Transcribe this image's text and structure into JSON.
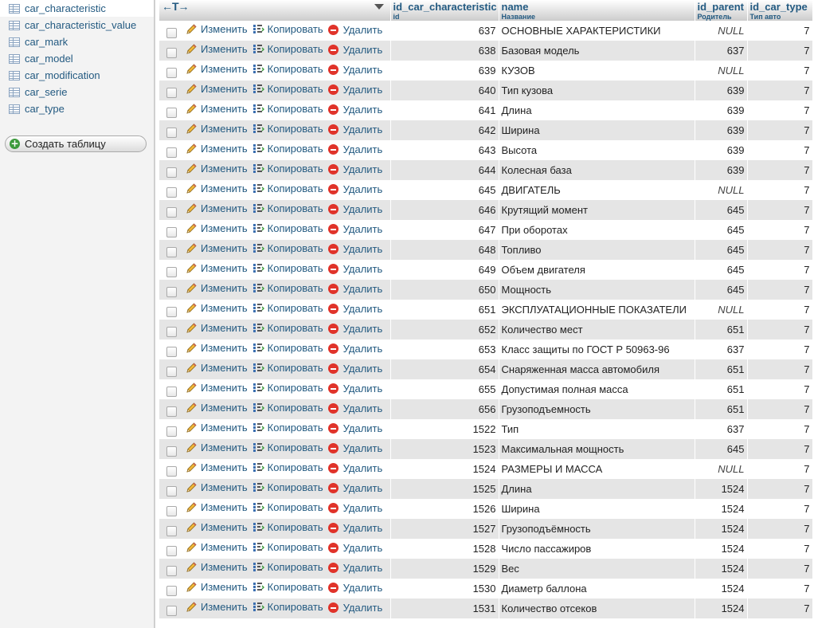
{
  "sidebar": {
    "tables": [
      {
        "name": "car_characteristic",
        "active": true
      },
      {
        "name": "car_characteristic_value",
        "active": false
      },
      {
        "name": "car_mark",
        "active": false
      },
      {
        "name": "car_model",
        "active": false
      },
      {
        "name": "car_modification",
        "active": false
      },
      {
        "name": "car_serie",
        "active": false
      },
      {
        "name": "car_type",
        "active": false
      }
    ],
    "create_table_label": "Создать таблицу"
  },
  "grid": {
    "header": {
      "arrows": "←T→",
      "columns": [
        {
          "name": "id_car_characteristic",
          "comment": "id"
        },
        {
          "name": "name",
          "comment": "Название"
        },
        {
          "name": "id_parent",
          "comment": "Родитель"
        },
        {
          "name": "id_car_type",
          "comment": "Тип авто"
        }
      ]
    },
    "actions": {
      "edit": "Изменить",
      "copy": "Копировать",
      "delete": "Удалить"
    },
    "null_label": "NULL",
    "rows": [
      {
        "id": "637",
        "name": "ОСНОВНЫЕ ХАРАКТЕРИСТИКИ",
        "parent": null,
        "type": "7"
      },
      {
        "id": "638",
        "name": "Базовая модель",
        "parent": "637",
        "type": "7"
      },
      {
        "id": "639",
        "name": "КУЗОВ",
        "parent": null,
        "type": "7"
      },
      {
        "id": "640",
        "name": "Тип кузова",
        "parent": "639",
        "type": "7"
      },
      {
        "id": "641",
        "name": "Длина",
        "parent": "639",
        "type": "7"
      },
      {
        "id": "642",
        "name": "Ширина",
        "parent": "639",
        "type": "7"
      },
      {
        "id": "643",
        "name": "Высота",
        "parent": "639",
        "type": "7"
      },
      {
        "id": "644",
        "name": "Колесная база",
        "parent": "639",
        "type": "7"
      },
      {
        "id": "645",
        "name": "ДВИГАТЕЛЬ",
        "parent": null,
        "type": "7"
      },
      {
        "id": "646",
        "name": "Крутящий момент",
        "parent": "645",
        "type": "7"
      },
      {
        "id": "647",
        "name": "При оборотах",
        "parent": "645",
        "type": "7"
      },
      {
        "id": "648",
        "name": "Топливо",
        "parent": "645",
        "type": "7"
      },
      {
        "id": "649",
        "name": "Объем двигателя",
        "parent": "645",
        "type": "7"
      },
      {
        "id": "650",
        "name": "Мощность",
        "parent": "645",
        "type": "7"
      },
      {
        "id": "651",
        "name": "ЭКСПЛУАТАЦИОННЫЕ ПОКАЗАТЕЛИ",
        "parent": null,
        "type": "7"
      },
      {
        "id": "652",
        "name": "Количество мест",
        "parent": "651",
        "type": "7"
      },
      {
        "id": "653",
        "name": "Класс защиты по ГОСТ Р 50963-96",
        "parent": "637",
        "type": "7"
      },
      {
        "id": "654",
        "name": "Снаряженная масса автомобиля",
        "parent": "651",
        "type": "7"
      },
      {
        "id": "655",
        "name": "Допустимая полная масса",
        "parent": "651",
        "type": "7"
      },
      {
        "id": "656",
        "name": "Грузоподъемность",
        "parent": "651",
        "type": "7"
      },
      {
        "id": "1522",
        "name": "Тип",
        "parent": "637",
        "type": "7"
      },
      {
        "id": "1523",
        "name": "Максимальная мощность",
        "parent": "645",
        "type": "7"
      },
      {
        "id": "1524",
        "name": "РАЗМЕРЫ И МАССА",
        "parent": null,
        "type": "7"
      },
      {
        "id": "1525",
        "name": "Длина",
        "parent": "1524",
        "type": "7"
      },
      {
        "id": "1526",
        "name": "Ширина",
        "parent": "1524",
        "type": "7"
      },
      {
        "id": "1527",
        "name": "Грузоподъёмность",
        "parent": "1524",
        "type": "7"
      },
      {
        "id": "1528",
        "name": "Число пассажиров",
        "parent": "1524",
        "type": "7"
      },
      {
        "id": "1529",
        "name": "Вес",
        "parent": "1524",
        "type": "7"
      },
      {
        "id": "1530",
        "name": "Диаметр баллона",
        "parent": "1524",
        "type": "7"
      },
      {
        "id": "1531",
        "name": "Количество отсеков",
        "parent": "1524",
        "type": "7"
      }
    ]
  }
}
